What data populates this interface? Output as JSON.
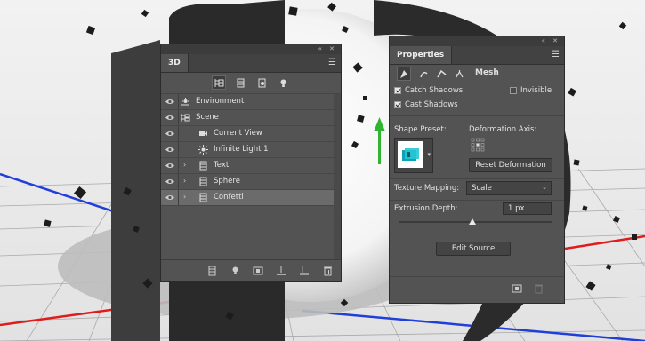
{
  "panel_3d": {
    "tab_label": "3D",
    "layers": [
      {
        "label": "Environment",
        "type": "environment",
        "expandable": false,
        "indent": 0
      },
      {
        "label": "Scene",
        "type": "scene",
        "expandable": false,
        "indent": 0
      },
      {
        "label": "Current View",
        "type": "camera",
        "expandable": false,
        "indent": 1
      },
      {
        "label": "Infinite Light 1",
        "type": "light",
        "expandable": false,
        "indent": 1
      },
      {
        "label": "Text",
        "type": "mesh",
        "expandable": true,
        "indent": 1
      },
      {
        "label": "Sphere",
        "type": "mesh",
        "expandable": true,
        "indent": 1
      },
      {
        "label": "Confetti",
        "type": "mesh",
        "expandable": true,
        "indent": 1,
        "selected": true
      }
    ]
  },
  "properties": {
    "tab_label": "Properties",
    "mesh_tab_label": "Mesh",
    "catch_shadows_label": "Catch Shadows",
    "catch_shadows_checked": true,
    "invisible_label": "Invisible",
    "invisible_checked": false,
    "cast_shadows_label": "Cast Shadows",
    "cast_shadows_checked": true,
    "shape_preset_label": "Shape Preset:",
    "deformation_axis_label": "Deformation Axis:",
    "reset_deformation_label": "Reset Deformation",
    "texture_mapping_label": "Texture Mapping:",
    "texture_mapping_value": "Scale",
    "extrusion_depth_label": "Extrusion Depth:",
    "extrusion_depth_value": "1 px",
    "edit_source_label": "Edit Source"
  },
  "colors": {
    "panel_bg": "#535353",
    "selected_row": "#6b6b6b",
    "axis_x": "#e01b1b",
    "axis_z": "#1f3fd8",
    "axis_y": "#2fb52f"
  }
}
